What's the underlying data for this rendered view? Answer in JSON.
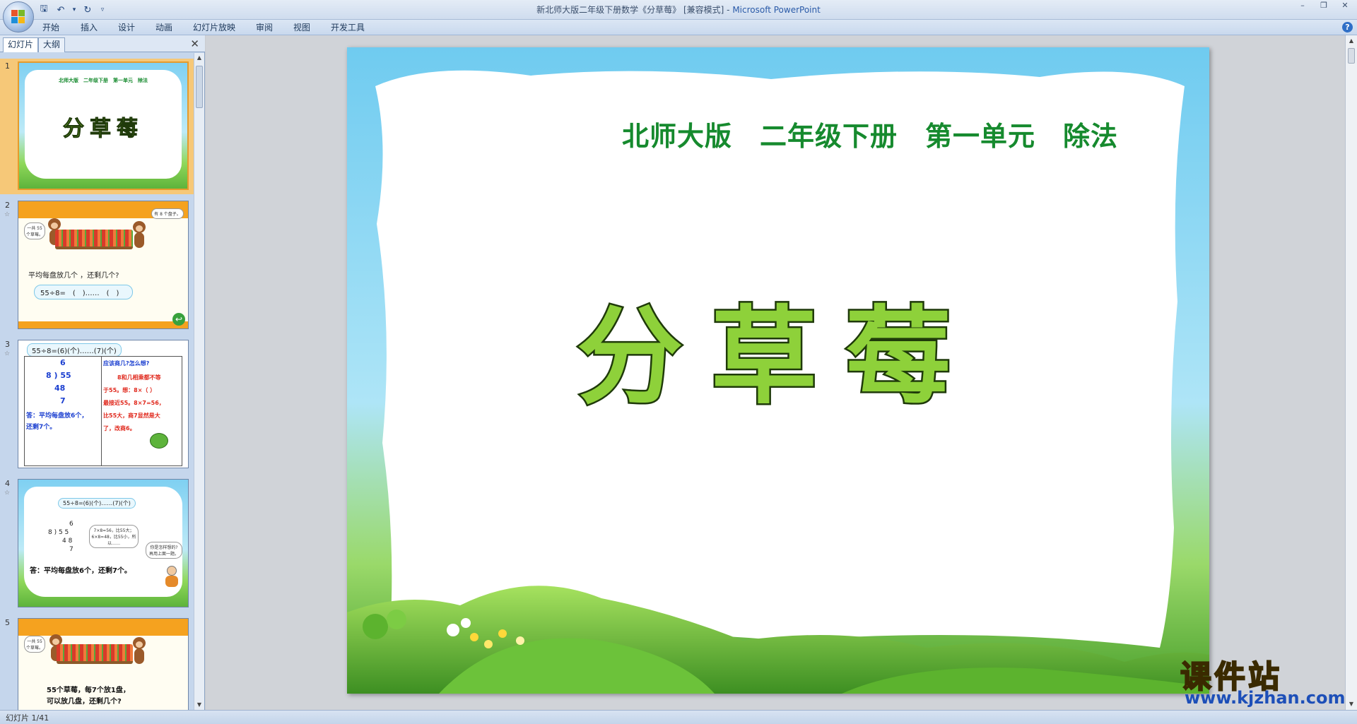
{
  "window": {
    "title": "新北师大版二年级下册数学《分草莓》 [兼容模式] - ",
    "app_name": "Microsoft PowerPoint"
  },
  "quick_access": {
    "items": [
      {
        "name": "save-icon",
        "glyph": "🖫"
      },
      {
        "name": "undo-icon",
        "glyph": "↶"
      },
      {
        "name": "dropdown-icon",
        "glyph": "▾"
      },
      {
        "name": "redo-icon",
        "glyph": "↻"
      },
      {
        "name": "customize-icon",
        "glyph": "▿"
      }
    ]
  },
  "window_controls": {
    "minimize": "–",
    "restore": "❐",
    "close": "✕"
  },
  "ribbon": {
    "tabs": [
      "开始",
      "插入",
      "设计",
      "动画",
      "幻灯片放映",
      "审阅",
      "视图",
      "开发工具"
    ],
    "help": "?"
  },
  "pane": {
    "tab_slides": "幻灯片",
    "tab_outline": "大纲",
    "close": "✕"
  },
  "thumbnails": [
    {
      "num": "1",
      "subtitle": "北师大版　二年级下册　第一单元　除法",
      "title": "分草莓"
    },
    {
      "num": "2",
      "bubble_left": "一共 55 个草莓。",
      "bubble_right": "有 8 个盘子。",
      "question": "平均每盘放几个 ，还剩几个?",
      "equation": "55÷8=　(　)……　(　)"
    },
    {
      "num": "3",
      "header": "55÷8=(6)(个)……(7)(个)",
      "left_rows": [
        "6",
        "8 ) 55",
        "48",
        "7",
        "答：平均每盘放6个，",
        "还剩7个。"
      ],
      "right_rows": [
        "应该商几?怎么想?",
        "8和几相乘都不等",
        "于55。想：8×（  ）",
        "最接近55。8×7=56，",
        "比55大，商7显然是大",
        "了，改商6。"
      ]
    },
    {
      "num": "4",
      "header": "55÷8=(6)(个)……(7)(个)",
      "division": [
        "6",
        "8 ) 5 5",
        "4 8",
        "7"
      ],
      "bubble_left": "7×8=56，比55大；6×8=48，比55小，所以……",
      "bubble_right": "你是怎样想的? 再用上面一题。",
      "answer": "答：平均每盘放6个，还剩7个。"
    },
    {
      "num": "5",
      "bubble_left": "一共 55 个草莓。",
      "text1": "55个草莓，每7个放1盘，",
      "text2": "可以放几盘，还剩几个?"
    }
  ],
  "slide": {
    "subtitle": "北师大版　二年级下册　第一单元　除法",
    "title": "分草莓"
  },
  "colors": {
    "subtitle": "#168a2e",
    "title_fill": "#8ed13a",
    "title_stroke": "#1f3a0a",
    "watermark_text": "#ffe600",
    "watermark_url": "#1d4fb8"
  },
  "status": {
    "slide_indicator": "幻灯片 1/41"
  },
  "watermark": {
    "title": "课件站",
    "url": "www.kjzhan.com"
  }
}
